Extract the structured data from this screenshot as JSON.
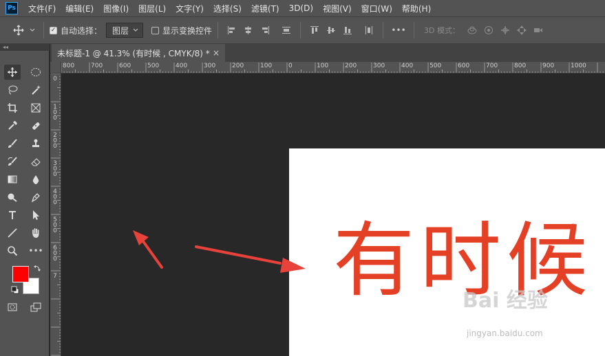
{
  "app": {
    "logo_text": "Ps"
  },
  "menu": [
    "文件(F)",
    "编辑(E)",
    "图像(I)",
    "图层(L)",
    "文字(Y)",
    "选择(S)",
    "滤镜(T)",
    "3D(D)",
    "视图(V)",
    "窗口(W)",
    "帮助(H)"
  ],
  "options_bar": {
    "auto_select_label": "自动选择：",
    "auto_select_checked": true,
    "layer_select_value": "图层",
    "show_transform_label": "显示变换控件",
    "show_transform_checked": false,
    "mode_3d_label": "3D 模式：",
    "more_label": "•••"
  },
  "toolbar": {
    "collapse_label": "◂◂",
    "more_tools_label": "•••",
    "foreground_color": "#ff0000",
    "background_color": "#ffffff"
  },
  "document_tab": {
    "title": "未标题-1 @ 41.3% (有时候 , CMYK/8) *",
    "close_label": "×"
  },
  "rulers": {
    "horizontal": [
      "800",
      "700",
      "600",
      "500",
      "400",
      "300",
      "200",
      "100",
      "0",
      "100",
      "200",
      "300",
      "400",
      "500",
      "600",
      "700",
      "800",
      "900",
      "1000"
    ],
    "vertical": [
      "0",
      "1\n0\n0",
      "2\n0\n0",
      "3\n0\n0",
      "4\n0\n0",
      "5\n0\n0",
      "6\n0\n0",
      "7"
    ]
  },
  "canvas": {
    "text": "有时候",
    "text_color": "#e44026",
    "arrow_color": "#e8423a"
  },
  "watermark": {
    "text": "Bai 经验",
    "url": "jingyan.baidu.com"
  }
}
